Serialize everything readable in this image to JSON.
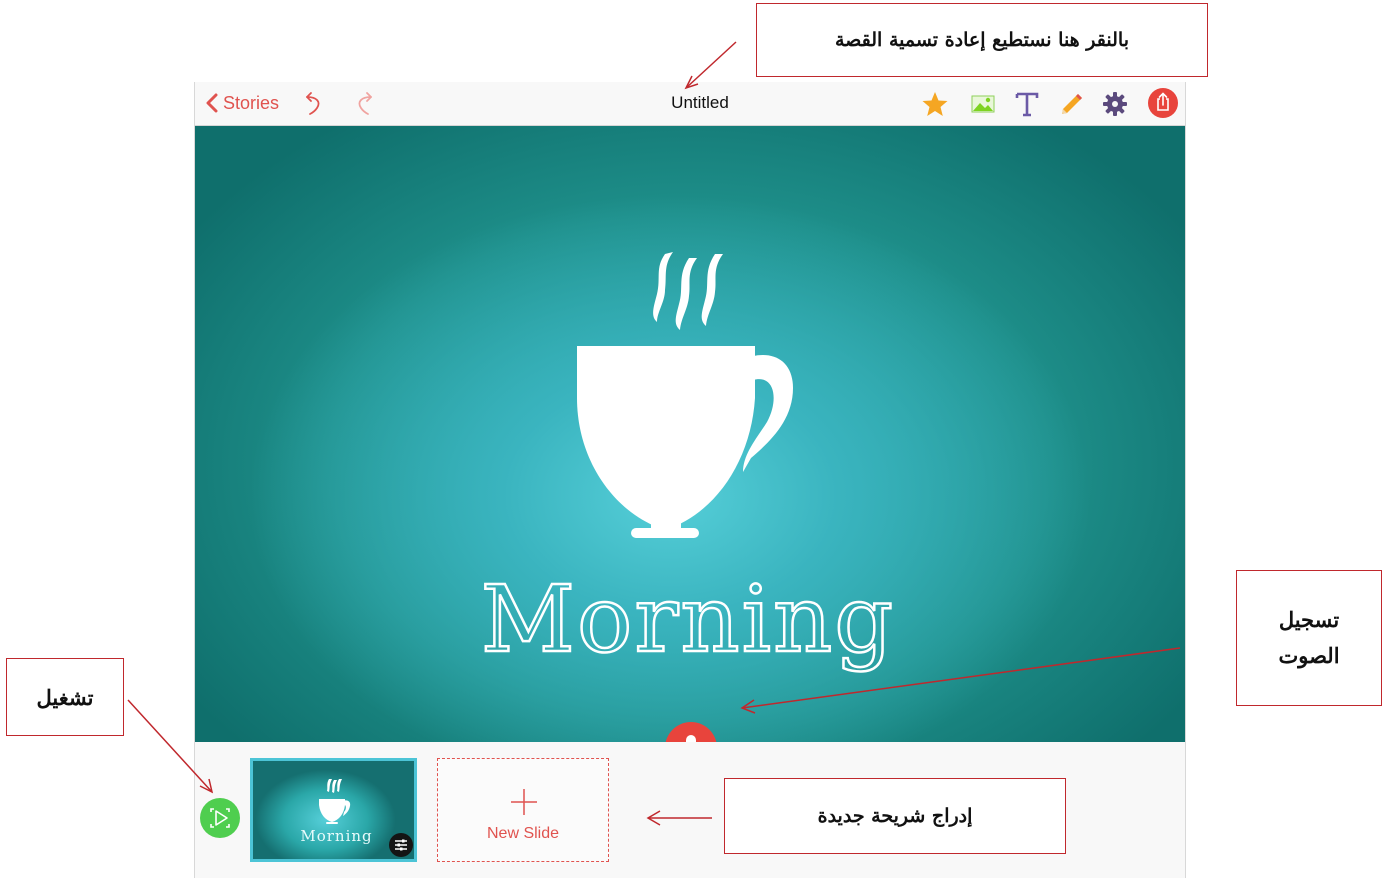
{
  "toolbar": {
    "back_label": "Stories",
    "title": "Untitled",
    "tools": [
      "undo-icon",
      "redo-icon",
      "star-icon",
      "image-icon",
      "text-icon",
      "pencil-icon",
      "gear-icon",
      "share-icon"
    ]
  },
  "slide": {
    "title_text": "Morning",
    "image": "coffee-cup"
  },
  "tray": {
    "thumbnail_label": "Morning",
    "new_slide_label": "New Slide"
  },
  "annotations": {
    "rename": "بالنقر هنا نستطيع إعادة تسمية القصة",
    "record_line1": "تسجيل",
    "record_line2": "الصوت",
    "play": "تشغيل",
    "new_slide": "إدراج شريحة جديدة"
  },
  "colors": {
    "accent_red": "#e0534f",
    "mic_red": "#e8443c",
    "play_green": "#4fce4f",
    "star_orange": "#f5a623",
    "image_green": "#7ed321",
    "text_purple": "#6b5aa6",
    "callout_border": "#c0282d",
    "canvas_teal": "#2aa7a8"
  }
}
